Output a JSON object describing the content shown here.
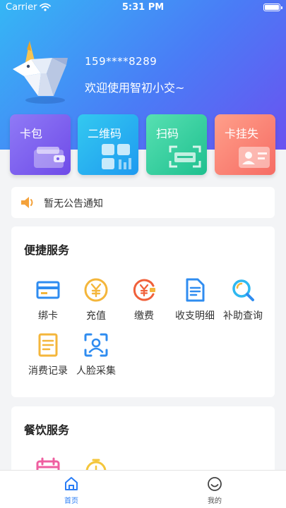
{
  "status_bar": {
    "carrier": "Carrier",
    "time": "5:31 PM"
  },
  "user": {
    "phone": "159****8289",
    "welcome": "欢迎使用智初小交~"
  },
  "cards": [
    {
      "label": "卡包",
      "icon": "wallet-icon"
    },
    {
      "label": "二维码",
      "icon": "qr-code-icon"
    },
    {
      "label": "扫码",
      "icon": "scan-icon"
    },
    {
      "label": "卡挂失",
      "icon": "id-card-icon"
    }
  ],
  "notice": {
    "text": "暂无公告通知",
    "icon": "speaker-icon"
  },
  "services": {
    "title": "便捷服务",
    "items": [
      {
        "label": "绑卡",
        "icon": "card-bind-icon"
      },
      {
        "label": "充值",
        "icon": "recharge-yen-icon"
      },
      {
        "label": "缴费",
        "icon": "payment-yen-icon"
      },
      {
        "label": "收支明细",
        "icon": "statement-document-icon"
      },
      {
        "label": "补助查询",
        "icon": "magnifier-icon"
      },
      {
        "label": "消费记录",
        "icon": "record-document-icon"
      },
      {
        "label": "人脸采集",
        "icon": "face-scan-icon"
      }
    ]
  },
  "dining": {
    "title": "餐饮服务",
    "icons": [
      "calendar-icon",
      "alarm-clock-icon"
    ]
  },
  "tabbar": {
    "tabs": [
      {
        "label": "首页",
        "icon": "home-icon",
        "active": true
      },
      {
        "label": "我的",
        "icon": "smile-face-icon",
        "active": false
      }
    ]
  },
  "colors": {
    "accent": "#2a7df5",
    "header_start": "#35b7f5",
    "header_end": "#6a52f0"
  }
}
